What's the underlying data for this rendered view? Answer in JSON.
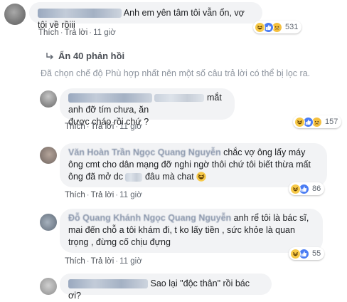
{
  "comments": [
    {
      "text": "Anh em yên tâm tôi vẫn ổn, vợ tôi về rồiii",
      "actions": {
        "like": "Thích",
        "reply": "Trả lời",
        "time": "11 giờ"
      },
      "reactions": {
        "count": "531",
        "icons": [
          "haha-icon",
          "like-icon",
          "sad-icon"
        ]
      }
    }
  ],
  "hidden_replies": {
    "label": "Ẩn 40 phản hồi"
  },
  "filter_note": "Đã chọn chế độ Phù hợp nhất nên một số câu trả lời có thể bị lọc ra.",
  "replies": [
    {
      "line1": "mắt anh đỡ tím chưa, ăn",
      "line2": "được cháo rồi chứ ?",
      "actions": {
        "like": "Thích",
        "reply": "Trả lời",
        "time": "11 giờ"
      },
      "reactions": {
        "count": "157",
        "icons": [
          "haha-icon",
          "like-icon",
          "sad-icon"
        ]
      }
    },
    {
      "author_faded": "Văn Hoàn Trần",
      "mention_faded": "Ngọc Quang Nguyễn",
      "line1": "chắc vợ ông lấy máy",
      "line2": "ông cmt cho dân mạng đỡ nghi ngờ thôi chứ tôi biết thừa mất",
      "line3a": "ông đã mở dc",
      "line3b": "đâu mà chat",
      "actions": {
        "like": "Thích",
        "reply": "Trả lời",
        "time": "11 giờ"
      },
      "reactions": {
        "count": "86",
        "icons": [
          "haha-icon",
          "like-icon"
        ]
      }
    },
    {
      "author_faded": "Đỗ Quang Khánh",
      "mention_faded": "Ngọc Quang Nguyễn",
      "line1": "anh rể tôi là bác sĩ,",
      "line2": "mai đến chỗ a tôi khám đi, t ko lấy tiền , sức khỏe là quan",
      "line3": "trọng , đừng cố chịu đựng",
      "actions": {
        "like": "Thích",
        "reply": "Trả lời",
        "time": "11 giờ"
      },
      "reactions": {
        "count": "55",
        "icons": [
          "haha-icon",
          "like-icon"
        ]
      }
    },
    {
      "line1": "Sao lại \"độc thân\" rồi bác ơi?"
    }
  ]
}
